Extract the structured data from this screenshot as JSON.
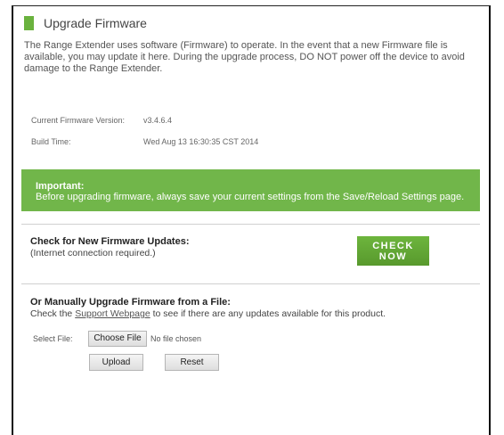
{
  "page": {
    "title": "Upgrade Firmware",
    "intro_line1": "The Range Extender uses software (Firmware) to operate. In the event that a new Firmware file is",
    "intro_line2": "available, you may update it here. During the upgrade process, DO NOT power off the device to avoid",
    "intro_line3": "damage to the Range Extender."
  },
  "firmware_info": {
    "current_version_label": "Current Firmware Version:",
    "current_version_value": "v3.4.6.4",
    "build_time_label": "Build Time:",
    "build_time_value": "Wed Aug 13 16:30:35 CST 2014"
  },
  "banner": {
    "title": "Important:",
    "text": "Before upgrading firmware, always save your current settings from the Save/Reload Settings page."
  },
  "check_updates": {
    "title": "Check for New Firmware Updates:",
    "subtitle": "(Internet connection required.)",
    "button_line1": "CHECK",
    "button_line2": "NOW"
  },
  "manual_upgrade": {
    "title": "Or Manually Upgrade Firmware from a File:",
    "text_before": "Check the ",
    "link": "Support Webpage",
    "text_after": " to see if there are any updates available for this product.",
    "select_label": "Select File:",
    "choose_button": "Choose File",
    "file_status": "No file chosen",
    "upload_button": "Upload",
    "reset_button": "Reset"
  },
  "colors": {
    "accent": "#6ab23e",
    "banner_bg": "#71b64a"
  }
}
